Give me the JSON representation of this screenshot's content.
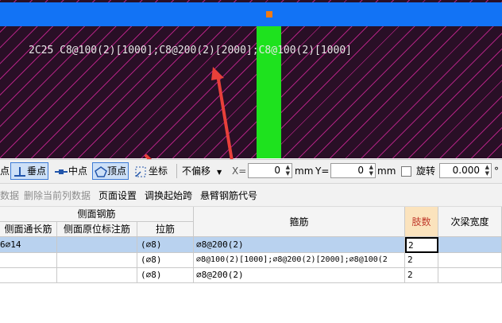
{
  "viewport": {
    "annotation": "2C25 C8@100(2)[1000];C8@200(2)[2000];C8@100(2)[1000]",
    "colors": {
      "background": "#290f26",
      "hatch": "#dc28a0",
      "beam": "#1273f5",
      "column": "#1ee21e",
      "grip": "#f27a11",
      "arrow": "#e8403a"
    }
  },
  "snapbar": {
    "point": "点",
    "perpendicular": "垂点",
    "midpoint": "中点",
    "vertex": "顶点",
    "coordinate": "坐标",
    "offset_mode": "不偏移",
    "x_label": "X=",
    "x_value": "0",
    "x_unit": "mm",
    "y_label": "Y=",
    "y_value": "0",
    "y_unit": "mm",
    "rotate_label": "旋转",
    "rotate_value": "0.000",
    "deg": "°"
  },
  "menubar": {
    "items": [
      "数据",
      "删除当前列数据",
      "页面设置",
      "调换起始跨",
      "悬臂钢筋代号"
    ]
  },
  "table": {
    "group_header": "侧面钢筋",
    "headers": [
      "侧面通长筋",
      "侧面原位标注筋",
      "拉筋",
      "箍筋",
      "肢数",
      "次梁宽度"
    ],
    "rows": [
      {
        "side_long": "6⌀14",
        "side_in_situ": "",
        "tie": "(⌀8)",
        "stirrup": "⌀8@200(2)",
        "legs": "2",
        "sec_width": ""
      },
      {
        "side_long": "",
        "side_in_situ": "",
        "tie": "(⌀8)",
        "stirrup": "⌀8@100(2)[1000];⌀8@200(2)[2000];⌀8@100(2",
        "legs": "2",
        "sec_width": ""
      },
      {
        "side_long": "",
        "side_in_situ": "",
        "tie": "(⌀8)",
        "stirrup": "⌀8@200(2)",
        "legs": "2",
        "sec_width": ""
      }
    ]
  }
}
